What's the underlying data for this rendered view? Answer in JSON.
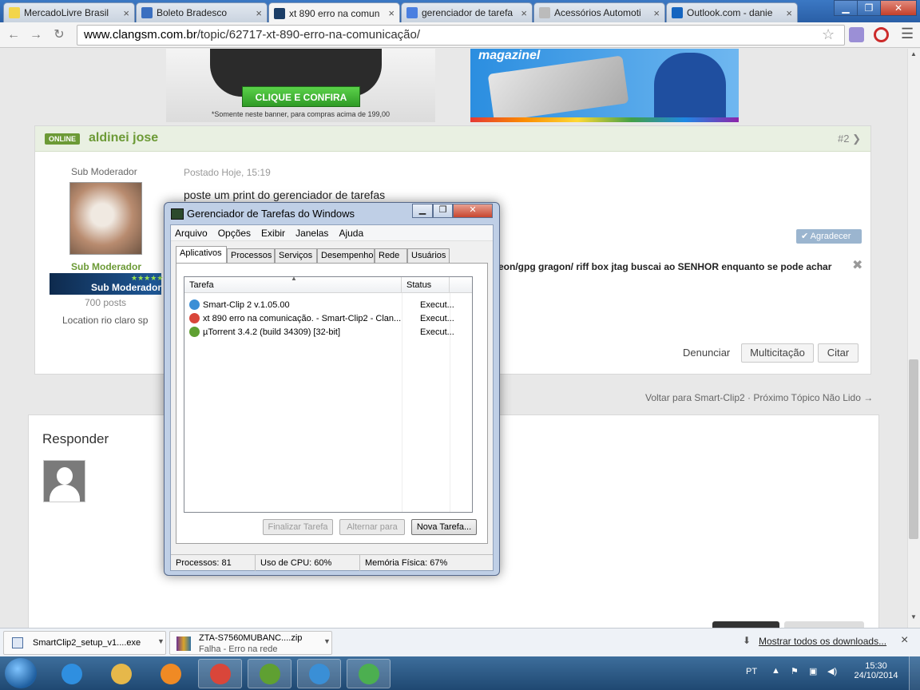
{
  "browser": {
    "tabs": [
      {
        "label": "MercadoLivre Brasil",
        "icon": "mercadolivre-icon",
        "color": "#f3d54a"
      },
      {
        "label": "Boleto Bradesco",
        "icon": "bradesco-icon",
        "color": "#3a6fc0"
      },
      {
        "label": "xt 890 erro na comun",
        "icon": "clangsm-icon",
        "color": "#1b3d66",
        "active": true
      },
      {
        "label": "gerenciador de tarefa",
        "icon": "google-icon",
        "color": "#4a7fe0"
      },
      {
        "label": "Acessórios Automoti",
        "icon": "page-icon",
        "color": "#bbbbbb"
      },
      {
        "label": "Outlook.com - danie",
        "icon": "outlook-icon",
        "color": "#1565c0"
      }
    ],
    "tab_close": "×",
    "window_buttons": {
      "minimize": "▁",
      "maximize": "❐",
      "close": "✕"
    },
    "url_domain": "www.clangsm.com.br",
    "url_path": "/topic/62717-xt-890-erro-na-comunicação/"
  },
  "ads": {
    "left_cta": "CLIQUE E CONFIRA",
    "left_note": "*Somente neste banner, para compras acima de 199,00",
    "right_brand": "magazinel"
  },
  "post": {
    "badge": "ONLINE",
    "author": "aldinei jose",
    "number": "#2",
    "role": "Sub Moderador",
    "rank_title": "Sub Moderador",
    "posts": "700 posts",
    "location": "Location rio claro sp",
    "posted": "Postado Hoje, 15:19",
    "body": "poste um print do gerenciador de tarefas",
    "thank": "Agradecer",
    "signature": "eon/gpg gragon/ riff box jtag buscai ao SENHOR enquanto se pode achar",
    "actions": {
      "report": "Denunciar",
      "multiquote": "Multicitação",
      "quote": "Citar"
    }
  },
  "thread_nav": {
    "back": "Voltar para Smart-Clip2",
    "next": "Próximo Tópico Não Lido →"
  },
  "reply": {
    "title": "Responder"
  },
  "taskmanager": {
    "title": "Gerenciador de Tarefas do Windows",
    "menu": [
      "Arquivo",
      "Opções",
      "Exibir",
      "Janelas",
      "Ajuda"
    ],
    "tabs": [
      "Aplicativos",
      "Processos",
      "Serviços",
      "Desempenho",
      "Rede",
      "Usuários"
    ],
    "columns": {
      "task": "Tarefa",
      "status": "Status"
    },
    "rows": [
      {
        "task": "Smart-Clip 2 v.1.05.00",
        "status": "Execut...",
        "icon": "smartclip-icon",
        "color": "#3a8fd6"
      },
      {
        "task": "xt 890 erro na comunicação. - Smart-Clip2 - Clan...",
        "status": "Execut...",
        "icon": "chrome-icon",
        "color": "#d9463a"
      },
      {
        "task": "µTorrent 3.4.2  (build 34309) [32-bit]",
        "status": "Execut...",
        "icon": "utorrent-icon",
        "color": "#5fa032"
      }
    ],
    "buttons": {
      "end_task": "Finalizar Tarefa",
      "switch_to": "Alternar para",
      "new_task": "Nova Tarefa..."
    },
    "status": {
      "processes": "Processos: 81",
      "cpu": "Uso de CPU: 60%",
      "memory": "Memória Física: 67%"
    }
  },
  "downloads": {
    "items": [
      {
        "name": "SmartClip2_setup_v1....exe",
        "status": ""
      },
      {
        "name": "ZTA-S7560MUBANC....zip",
        "status": "Falha - Erro na rede"
      }
    ],
    "show_all": "Mostrar todos os downloads...",
    "close": "×"
  },
  "taskbar": {
    "apps": [
      {
        "name": "internet-explorer-icon",
        "color": "#2f8fe0"
      },
      {
        "name": "explorer-folder-icon",
        "color": "#e6b84a"
      },
      {
        "name": "media-player-icon",
        "color": "#f08a24"
      },
      {
        "name": "chrome-icon",
        "color": "#d9463a"
      },
      {
        "name": "utorrent-icon",
        "color": "#5fa032"
      },
      {
        "name": "smartclip-icon",
        "color": "#3a8fd6"
      },
      {
        "name": "taskmanager-icon",
        "color": "#4caf50"
      }
    ],
    "lang": "PT",
    "time": "15:30",
    "date": "24/10/2014"
  }
}
